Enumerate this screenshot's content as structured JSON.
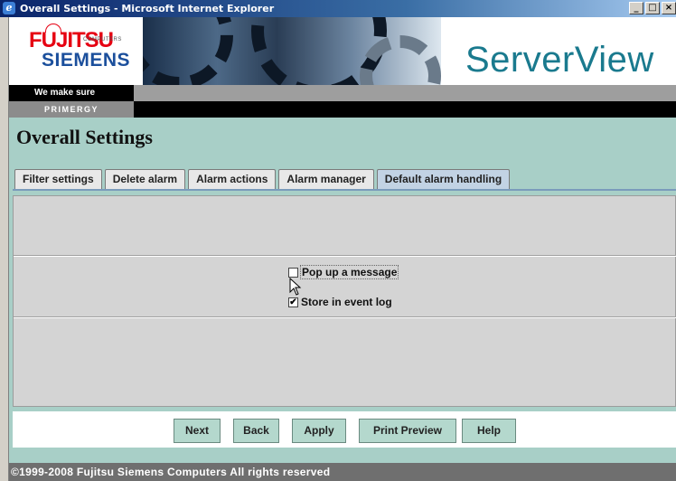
{
  "window": {
    "title": "Overall Settings - Microsoft Internet Explorer",
    "controls": [
      "_",
      "□",
      "×"
    ]
  },
  "header": {
    "logo_fujitsu": "FUJITSU",
    "logo_computers": "COMPUTERS",
    "logo_siemens": "SIEMENS",
    "product": "ServerView",
    "tagline": "We make sure",
    "brand_line": "PRIMERGY"
  },
  "page": {
    "title": "Overall Settings"
  },
  "tabs": [
    {
      "label": "Filter settings",
      "active": false
    },
    {
      "label": "Delete alarm",
      "active": false
    },
    {
      "label": "Alarm actions",
      "active": false
    },
    {
      "label": "Alarm manager",
      "active": false
    },
    {
      "label": "Default alarm handling",
      "active": true
    }
  ],
  "options": [
    {
      "label": "Pop up a message",
      "checked": false
    },
    {
      "label": "Store in event log",
      "checked": true
    }
  ],
  "buttons": {
    "next": "Next",
    "back": "Back",
    "apply": "Apply",
    "print_preview": "Print Preview",
    "help": "Help"
  },
  "footer": {
    "text": "©1999-2008  Fujitsu Siemens Computers  All rights reserved"
  },
  "colors": {
    "teal_bg": "#a8cfc7",
    "button_bg": "#b4d8cd",
    "product_text": "#1a7a8e"
  }
}
